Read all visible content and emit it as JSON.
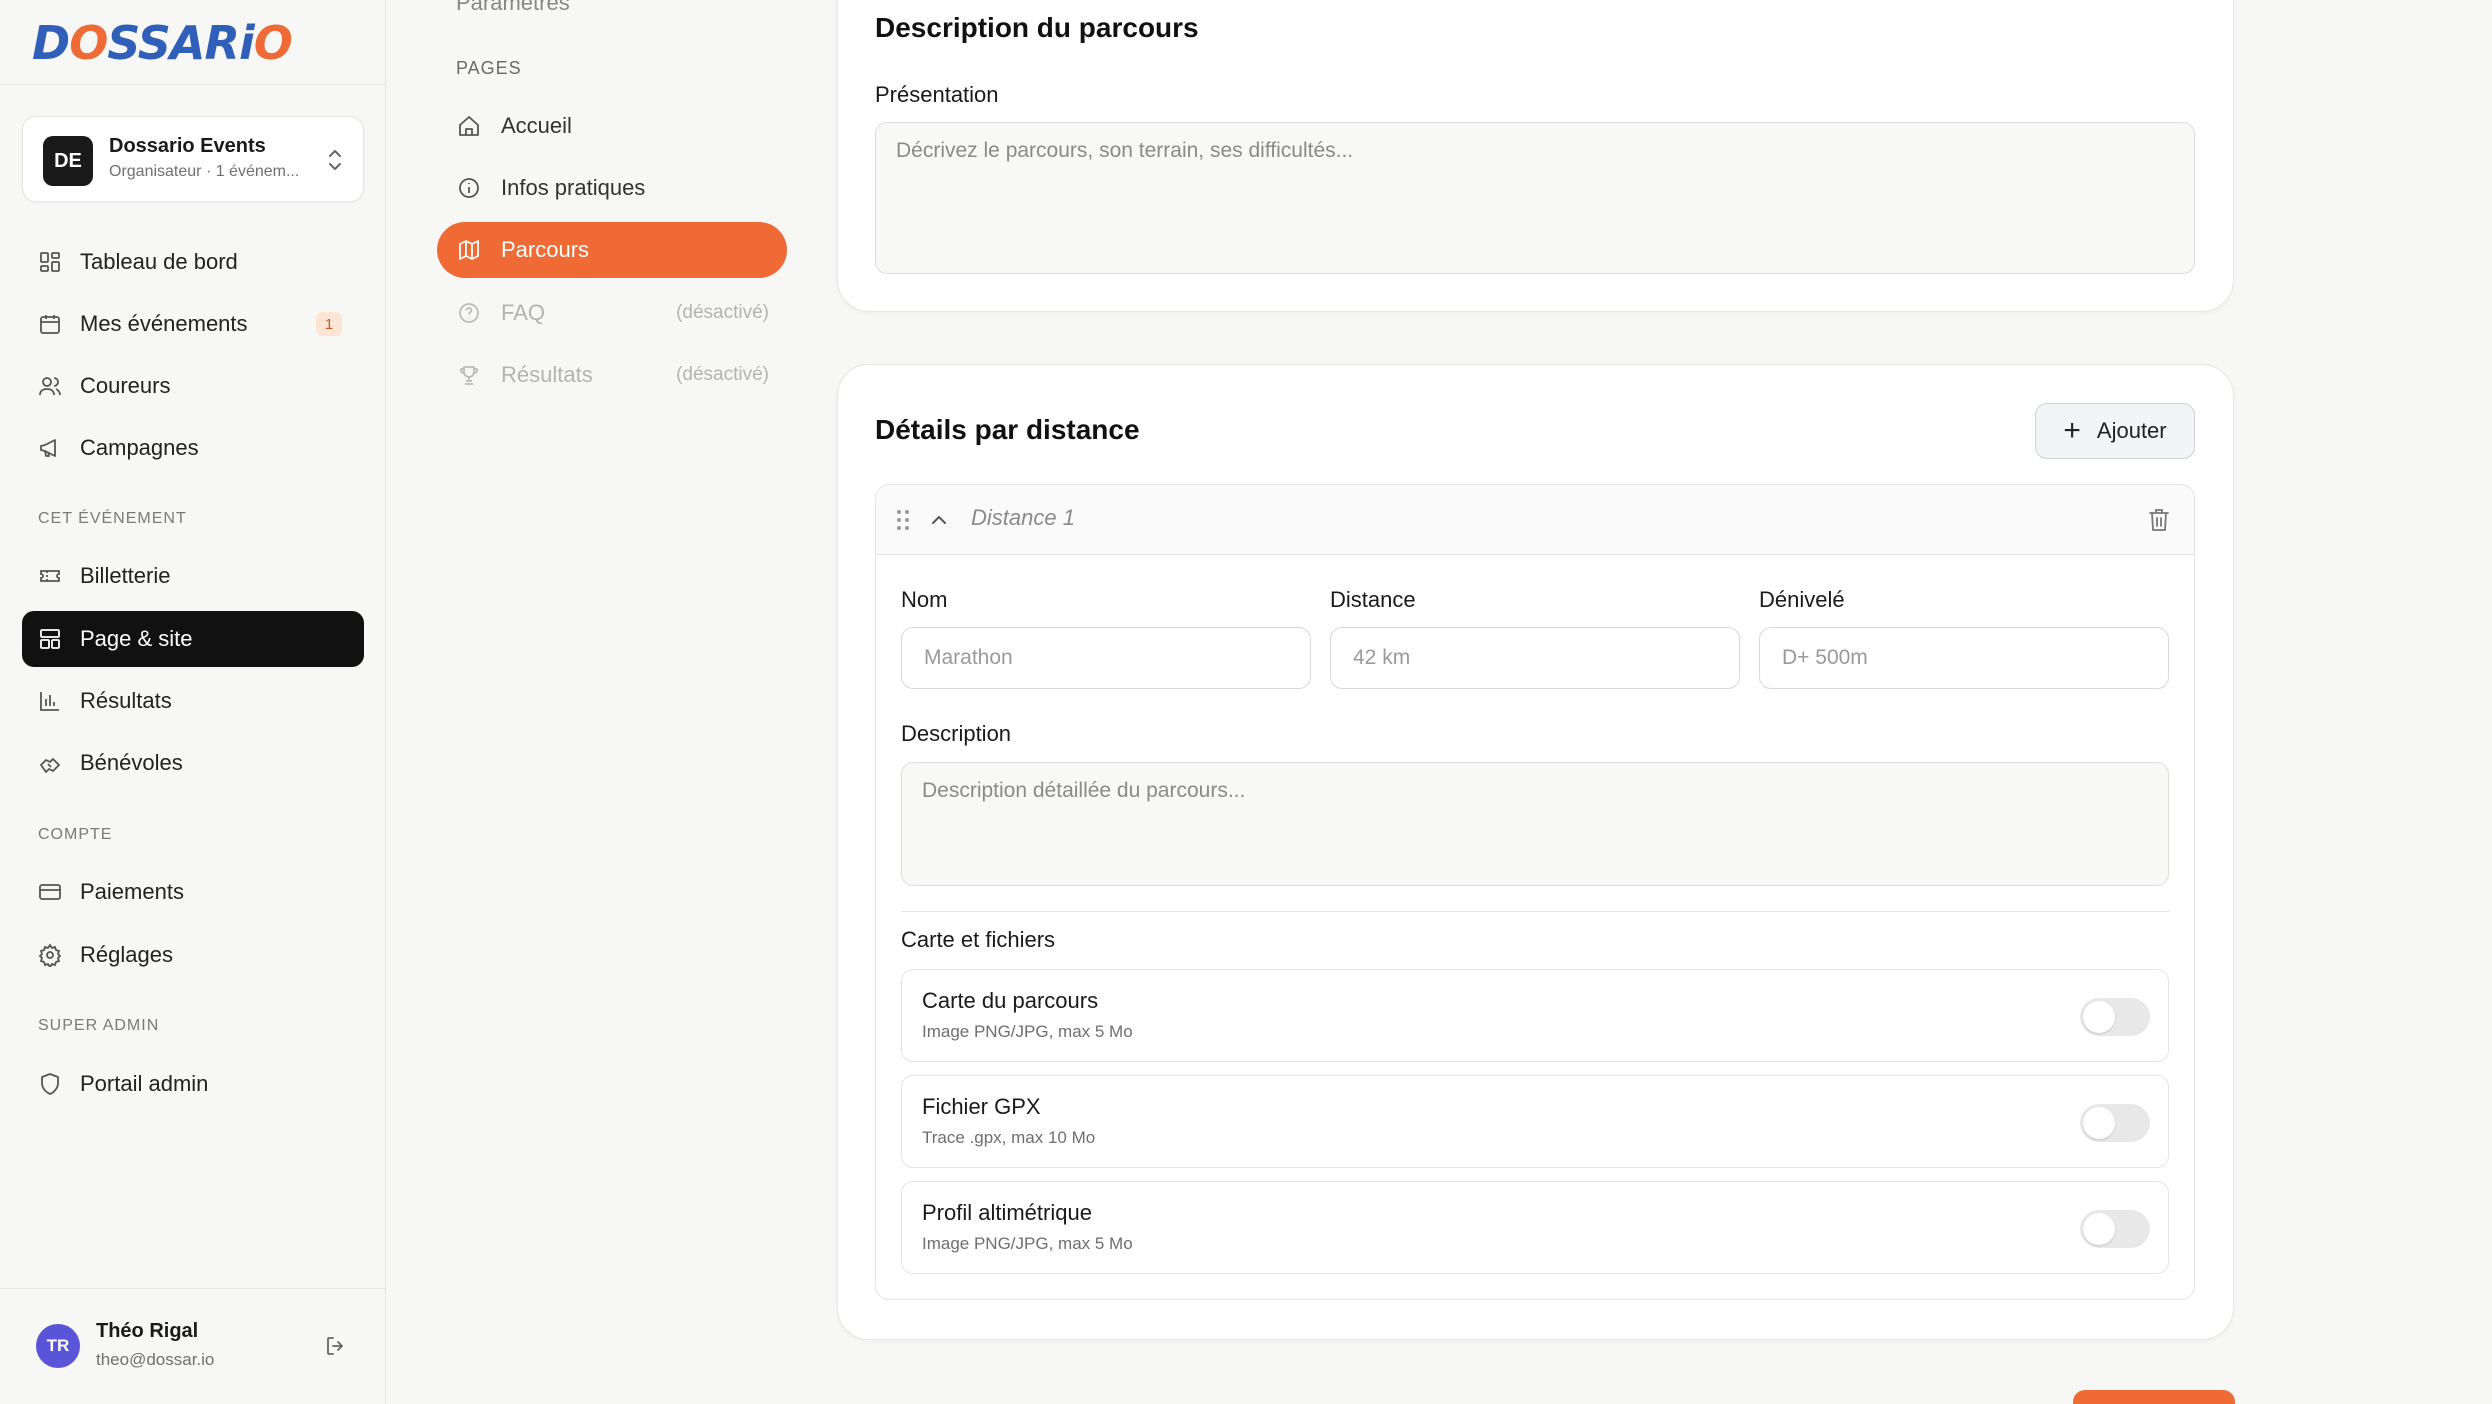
{
  "brand": {
    "logo_text": "DOSSARIO",
    "accent": "#ef6a35",
    "primary": "#2f5fb8"
  },
  "org": {
    "initials": "DE",
    "name": "Dossario Events",
    "subtitle": "Organisateur · 1 événem..."
  },
  "sidebar": {
    "items": [
      {
        "label": "Tableau de bord",
        "icon": "dashboard-icon"
      },
      {
        "label": "Mes événements",
        "icon": "calendar-icon",
        "badge": "1"
      },
      {
        "label": "Coureurs",
        "icon": "users-icon"
      },
      {
        "label": "Campagnes",
        "icon": "megaphone-icon"
      }
    ],
    "section_event": "CET ÉVÉNEMENT",
    "event_items": [
      {
        "label": "Billetterie",
        "icon": "ticket-icon"
      },
      {
        "label": "Page & site",
        "icon": "layout-icon",
        "active": true
      },
      {
        "label": "Résultats",
        "icon": "bar-chart-icon"
      },
      {
        "label": "Bénévoles",
        "icon": "handshake-icon"
      }
    ],
    "section_account": "COMPTE",
    "account_items": [
      {
        "label": "Paiements",
        "icon": "credit-card-icon"
      },
      {
        "label": "Réglages",
        "icon": "gear-icon"
      }
    ],
    "section_admin": "SUPER ADMIN",
    "admin_items": [
      {
        "label": "Portail admin",
        "icon": "shield-icon"
      }
    ]
  },
  "user": {
    "initials": "TR",
    "name": "Théo Rigal",
    "email": "theo@dossar.io"
  },
  "subnav": {
    "top_item": "Paramètres",
    "section_label": "PAGES",
    "items": [
      {
        "label": "Accueil",
        "icon": "home-icon"
      },
      {
        "label": "Infos pratiques",
        "icon": "info-icon"
      },
      {
        "label": "Parcours",
        "icon": "map-icon",
        "active": true
      },
      {
        "label": "FAQ",
        "icon": "help-icon",
        "tag": "(désactivé)"
      },
      {
        "label": "Résultats",
        "icon": "trophy-icon",
        "tag": "(désactivé)"
      }
    ]
  },
  "description_card": {
    "title": "Description du parcours",
    "presentation_label": "Présentation",
    "presentation_placeholder": "Décrivez le parcours, son terrain, ses difficultés..."
  },
  "distance_card": {
    "title": "Détails par distance",
    "add_label": "Ajouter",
    "distance_name": "Distance 1",
    "nom_label": "Nom",
    "nom_placeholder": "Marathon",
    "distance_label": "Distance",
    "distance_placeholder": "42 km",
    "denivele_label": "Dénivelé",
    "denivele_placeholder": "D+ 500m",
    "description_label": "Description",
    "description_placeholder": "Description détaillée du parcours...",
    "files_label": "Carte et fichiers",
    "files": [
      {
        "title": "Carte du parcours",
        "subtitle": "Image PNG/JPG, max 5 Mo",
        "enabled": false
      },
      {
        "title": "Fichier GPX",
        "subtitle": "Trace .gpx, max 10 Mo",
        "enabled": false
      },
      {
        "title": "Profil altimétrique",
        "subtitle": "Image PNG/JPG, max 5 Mo",
        "enabled": false
      }
    ]
  }
}
